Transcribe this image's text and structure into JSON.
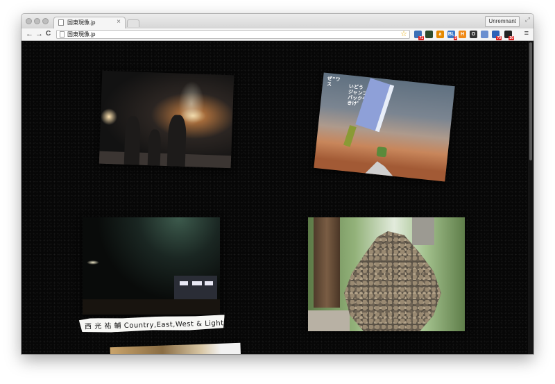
{
  "browser": {
    "tab_title": "国東現像.jp",
    "tab_close": "×",
    "user_button": "Unremnant",
    "url": "国東現像.jp",
    "icons": {
      "back": "←",
      "forward": "→",
      "reload": "C",
      "bookmark": "☆",
      "menu": "≡",
      "fullscreen": "⤢"
    },
    "extensions": [
      {
        "name": "ext-1",
        "label": "",
        "badge": "71",
        "color": "#3b6fb6"
      },
      {
        "name": "ext-2",
        "label": "",
        "badge": "",
        "color": "#2c4a2c"
      },
      {
        "name": "amazon",
        "label": "a",
        "badge": "",
        "color": "#e58a00"
      },
      {
        "name": "ext-bl",
        "label": "BL",
        "badge": "3",
        "color": "#3b77c9"
      },
      {
        "name": "ext-orange",
        "label": "H",
        "badge": "",
        "color": "#f08a18"
      },
      {
        "name": "ext-circle",
        "label": "O",
        "badge": "",
        "color": "#333333"
      },
      {
        "name": "ext-folder",
        "label": "",
        "badge": "",
        "color": "#6a8fd0"
      },
      {
        "name": "ext-hatena",
        "label": "",
        "badge": "73",
        "color": "#2d63b8"
      },
      {
        "name": "ext-avatar",
        "label": "",
        "badge": "20",
        "color": "#222222"
      }
    ]
  },
  "page": {
    "caption": "西 光 祐 輔  Country,East,West & Light.",
    "p2_text_left": "ぜ“ワ\nス",
    "p2_text_main": "いどう\nジャンプ\nバックや\nきけ゛ん"
  }
}
